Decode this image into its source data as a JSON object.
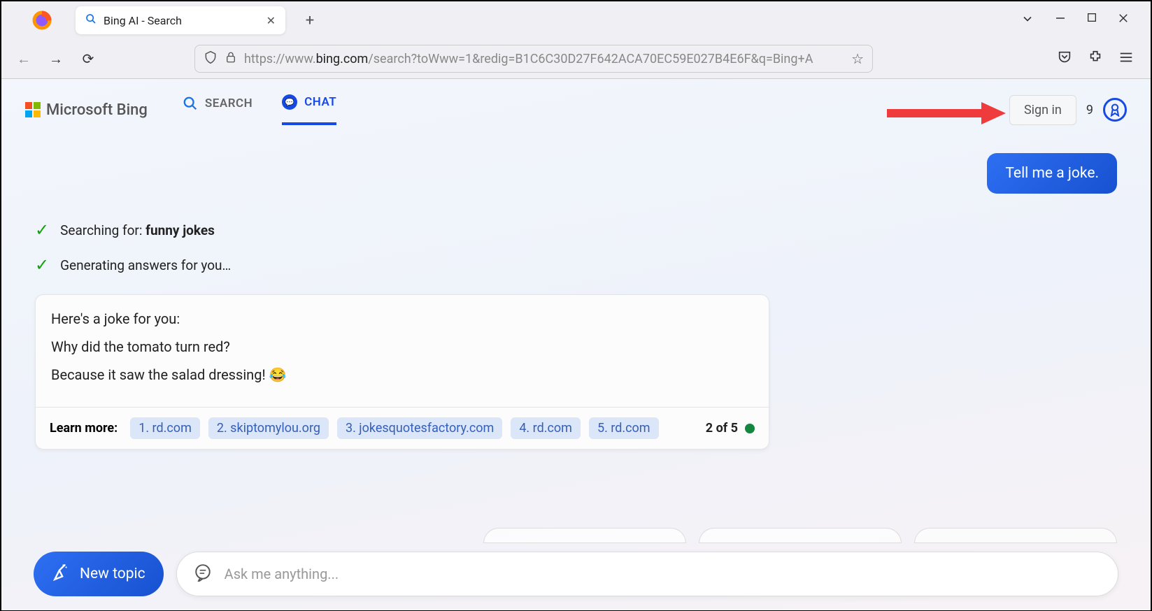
{
  "browser": {
    "tab_title": "Bing AI - Search",
    "new_tab": "+",
    "url_prefix": "https://www.",
    "url_domain": "bing.com",
    "url_path": "/search?toWww=1&redig=B1C6C30D27F642ACA70EC59E027B4E6F&q=Bing+A"
  },
  "header": {
    "logo_text": "Microsoft Bing",
    "tab_search": "SEARCH",
    "tab_chat": "CHAT",
    "signin": "Sign in",
    "rewards_count": "9"
  },
  "chat": {
    "user_message": "Tell me a joke.",
    "status_search_prefix": "Searching for: ",
    "status_search_term": "funny jokes",
    "status_generating": "Generating answers for you…",
    "answer_line1": "Here's a joke for you:",
    "answer_line2": "Why did the tomato turn red?",
    "answer_line3": "Because it saw the salad dressing! 😂",
    "learn_more": "Learn more:",
    "sources": [
      "1. rd.com",
      "2. skiptomylou.org",
      "3. jokesquotesfactory.com",
      "4. rd.com",
      "5. rd.com"
    ],
    "counter": "2 of 5"
  },
  "input": {
    "new_topic": "New topic",
    "placeholder": "Ask me anything..."
  }
}
